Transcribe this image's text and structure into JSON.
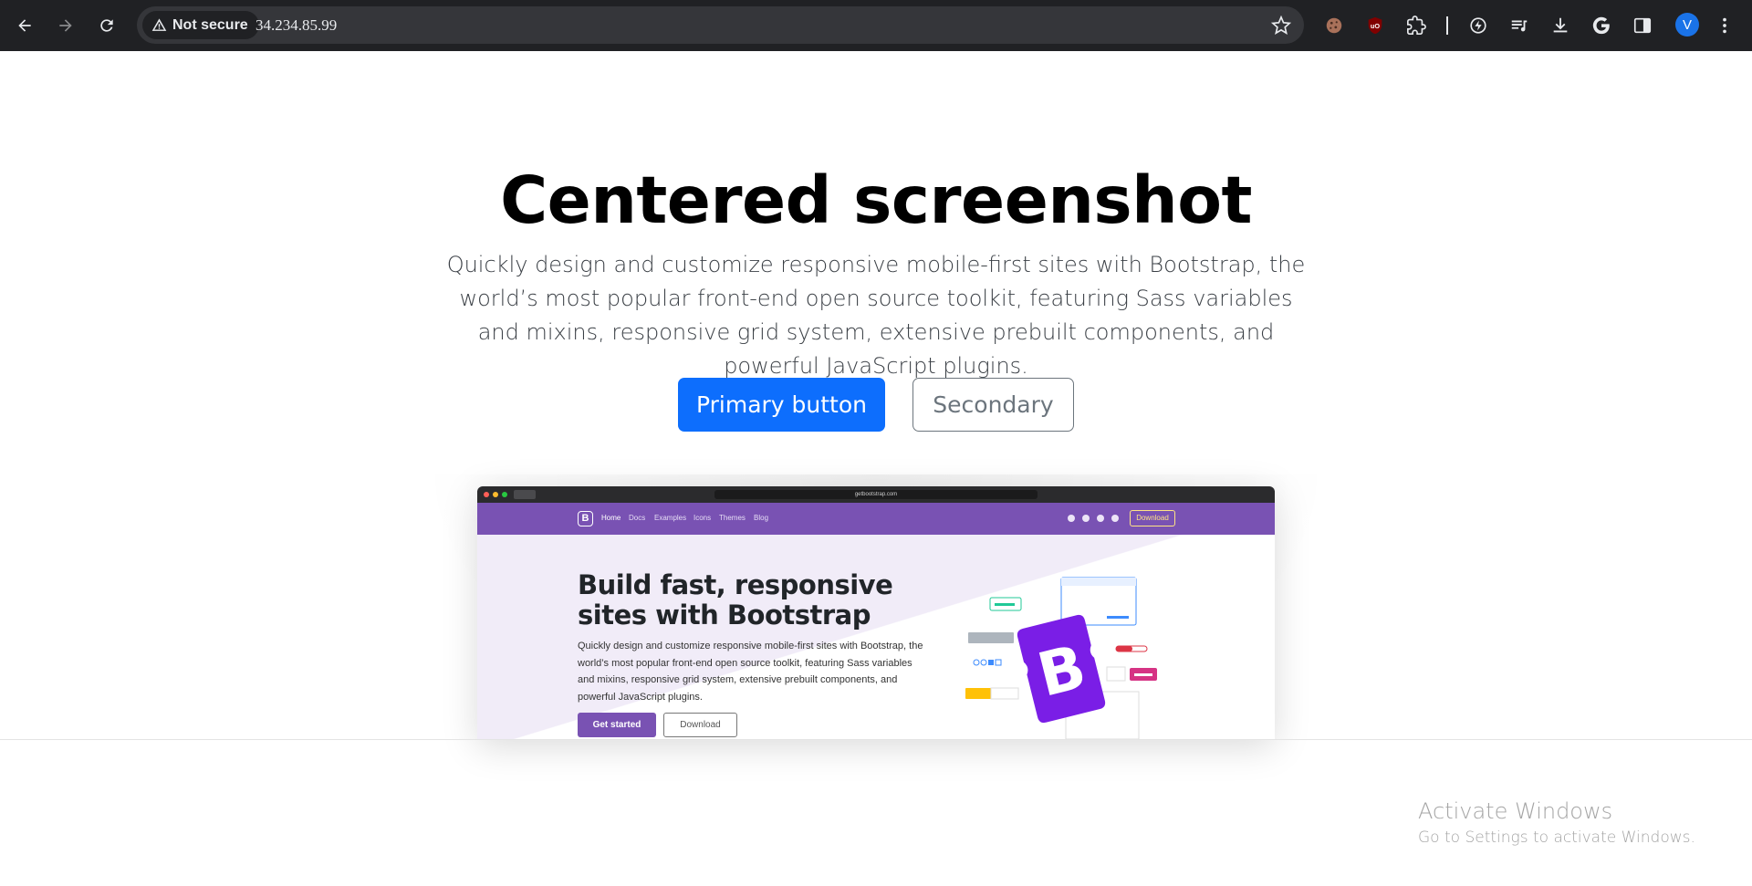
{
  "browser": {
    "security_label": "Not secure",
    "url": "34.234.85.99",
    "avatar_letter": "V"
  },
  "hero": {
    "title": "Centered screenshot",
    "lead": "Quickly design and customize responsive mobile-first sites with Bootstrap, the world’s most popular front-end open source toolkit, featuring Sass variables and mixins, responsive grid system, extensive prebuilt components, and powerful JavaScript plugins.",
    "primary_button": "Primary button",
    "secondary_button": "Secondary"
  },
  "mockup": {
    "url": "getbootstrap.com",
    "logo": "B",
    "nav": [
      "Home",
      "Docs",
      "Examples",
      "Icons",
      "Themes",
      "Blog"
    ],
    "download_btn": "Download",
    "heading": "Build fast, responsive sites with Bootstrap",
    "paragraph": "Quickly design and customize responsive mobile-first sites with Bootstrap, the world’s most popular front-end open source toolkit, featuring Sass variables and mixins, responsive grid system, extensive prebuilt components, and powerful JavaScript plugins.",
    "get_started": "Get started",
    "download": "Download",
    "big_logo": "B"
  },
  "watermark": {
    "title": "Activate Windows",
    "subtitle": "Go to Settings to activate Windows."
  },
  "colors": {
    "chrome_bg": "#202124",
    "primary": "#0d6efd",
    "bootstrap_purple": "#7952b3"
  }
}
